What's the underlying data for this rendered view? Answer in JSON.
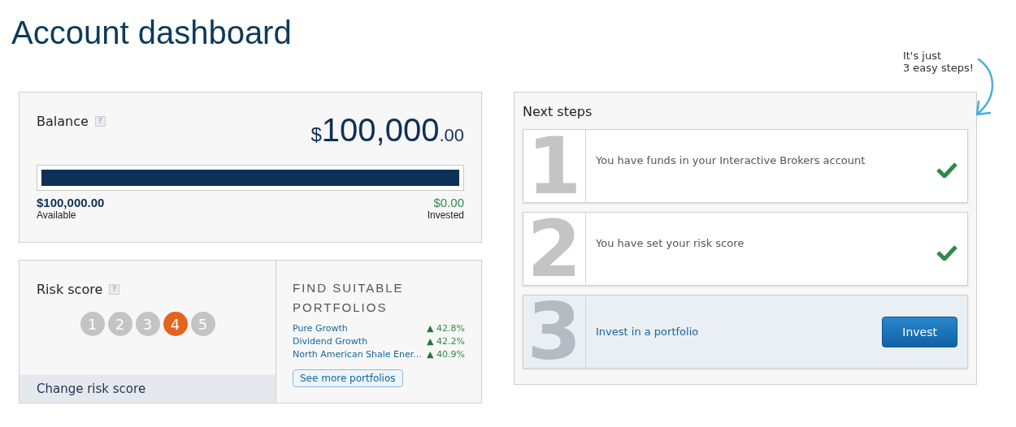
{
  "title": "Account dashboard",
  "balance": {
    "label": "Balance",
    "help": "?",
    "currency": "$",
    "amount": "100,000",
    "cents": ".00",
    "level": 1,
    "available_amount": "$100,000.00",
    "available_label": "Available",
    "invested_amount": "$0.00",
    "invested_label": "Invested"
  },
  "risk": {
    "label": "Risk score",
    "help": "?",
    "scores": [
      {
        "label": "1",
        "selected": false
      },
      {
        "label": "2",
        "selected": false
      },
      {
        "label": "3",
        "selected": false
      },
      {
        "label": "4",
        "selected": true
      },
      {
        "label": "5",
        "selected": false
      }
    ],
    "change_link": "Change risk score"
  },
  "portfolios": {
    "heading_lines": [
      "FIND SUITABLE",
      "PORTFOLIOS"
    ],
    "items": [
      {
        "name": "Pure Growth",
        "arrow": "▲",
        "change": "42.8%"
      },
      {
        "name": "Dividend Growth",
        "arrow": "▲",
        "change": "42.2%"
      },
      {
        "name": "North American Shale Ener...",
        "arrow": "▲",
        "change": "40.9%"
      }
    ],
    "more_button": "See more portfolios"
  },
  "annotation": [
    "It's just",
    "3 easy steps!"
  ],
  "next_steps": {
    "title": "Next steps",
    "steps": [
      {
        "number": "1",
        "text": "You have funds in your Interactive Brokers account",
        "kind": "done"
      },
      {
        "number": "2",
        "text": "You have set your risk score",
        "kind": "done"
      },
      {
        "number": "3",
        "text": "Invest in a portfolio",
        "kind": "action",
        "button": "Invest"
      }
    ]
  }
}
